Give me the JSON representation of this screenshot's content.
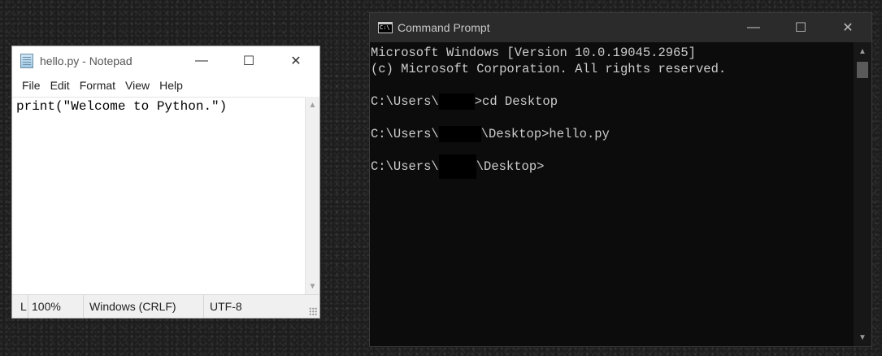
{
  "notepad": {
    "title": "hello.py - Notepad",
    "controls": {
      "minimize": "—",
      "maximize": "☐",
      "close": "✕"
    },
    "menu": [
      "File",
      "Edit",
      "Format",
      "View",
      "Help"
    ],
    "content": "print(\"Welcome to Python.\")",
    "status": {
      "position": "L",
      "zoom": "100%",
      "line_ending": "Windows (CRLF)",
      "encoding": "UTF-8"
    }
  },
  "cmd": {
    "title": "Command Prompt",
    "controls": {
      "minimize": "—",
      "maximize": "☐",
      "close": "✕"
    },
    "lines": {
      "version": "Microsoft Windows [Version 10.0.19045.2965]",
      "copyright": "(c) Microsoft Corporation. All rights reserved.",
      "prompt1_prefix": "C:\\Users\\",
      "prompt1_suffix": ">cd Desktop",
      "prompt2_prefix": "C:\\Users\\",
      "prompt2_suffix": "\\Desktop>hello.py",
      "prompt3_prefix": "C:\\Users\\",
      "prompt3_suffix": "\\Desktop>"
    }
  }
}
